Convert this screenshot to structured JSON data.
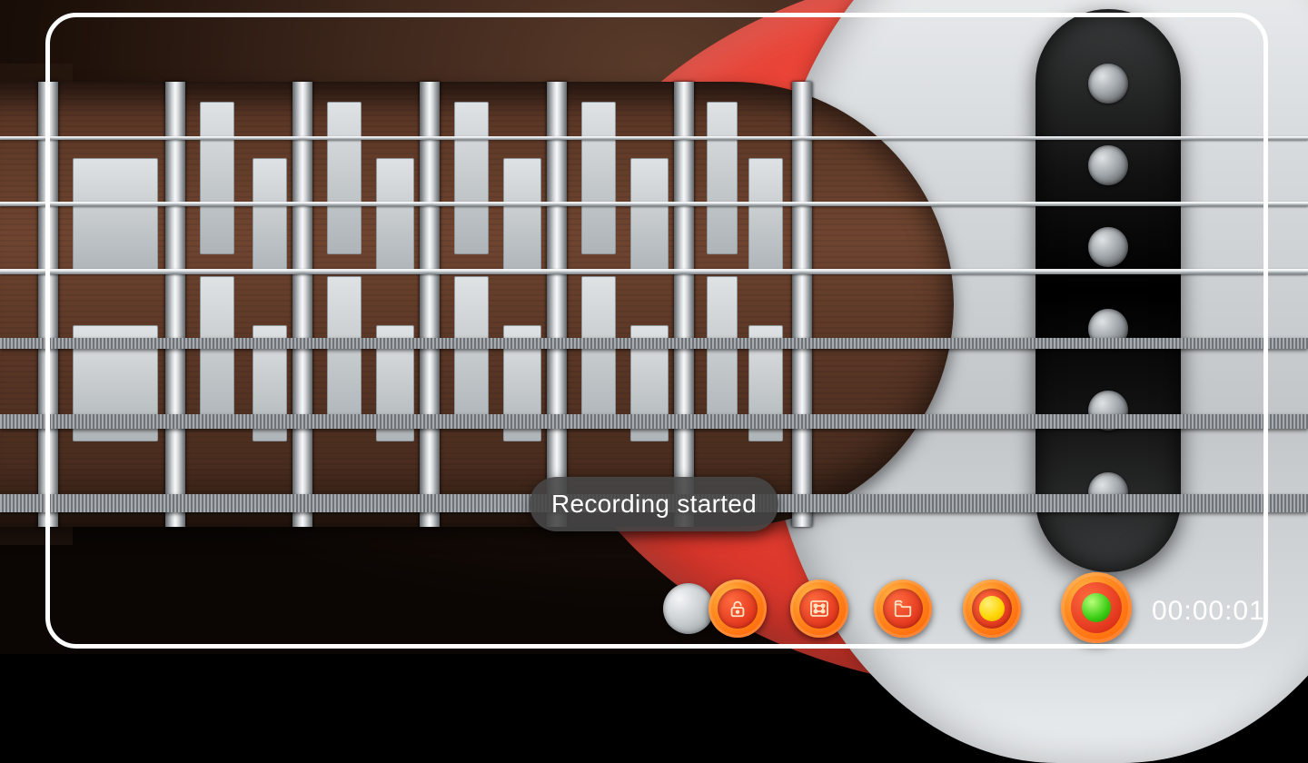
{
  "toast": {
    "text": "Recording started"
  },
  "timer": {
    "value": "00:00:01"
  },
  "instrument": {
    "type": "bass-guitar",
    "body_color": "#e03a2e",
    "neck_color": "#5b3726",
    "pickguard_color": "#d6dadd",
    "string_count": 6,
    "visible_fret_count": 7
  },
  "toolbar": {
    "lock_label": "Lock",
    "tuner_label": "Tuner",
    "folder_label": "Recordings",
    "record_label": "Record",
    "record_active": true,
    "accent": "#ff7a1f"
  }
}
